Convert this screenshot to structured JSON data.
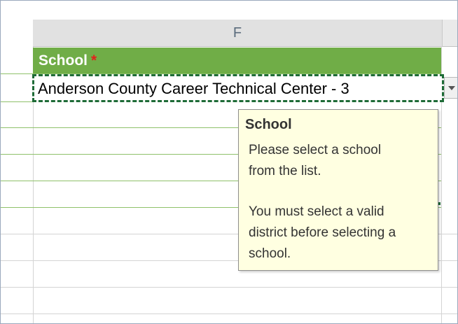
{
  "spreadsheet": {
    "column_header": "F",
    "header_row": {
      "label": "School",
      "required_mark": "*"
    },
    "selected_cell": {
      "value": "Anderson County Career  Technical Center - 3"
    }
  },
  "tooltip": {
    "title": "School",
    "lines": [
      "Please select a school",
      "from the list.",
      "You must select a valid",
      "district before selecting a",
      "school."
    ]
  },
  "colors": {
    "header_green": "#70ad47",
    "selection_border": "#1e6b37",
    "tooltip_background": "#ffffe1",
    "required_red": "#e0231c"
  },
  "icons": {
    "dropdown": "chevron-down-icon"
  }
}
